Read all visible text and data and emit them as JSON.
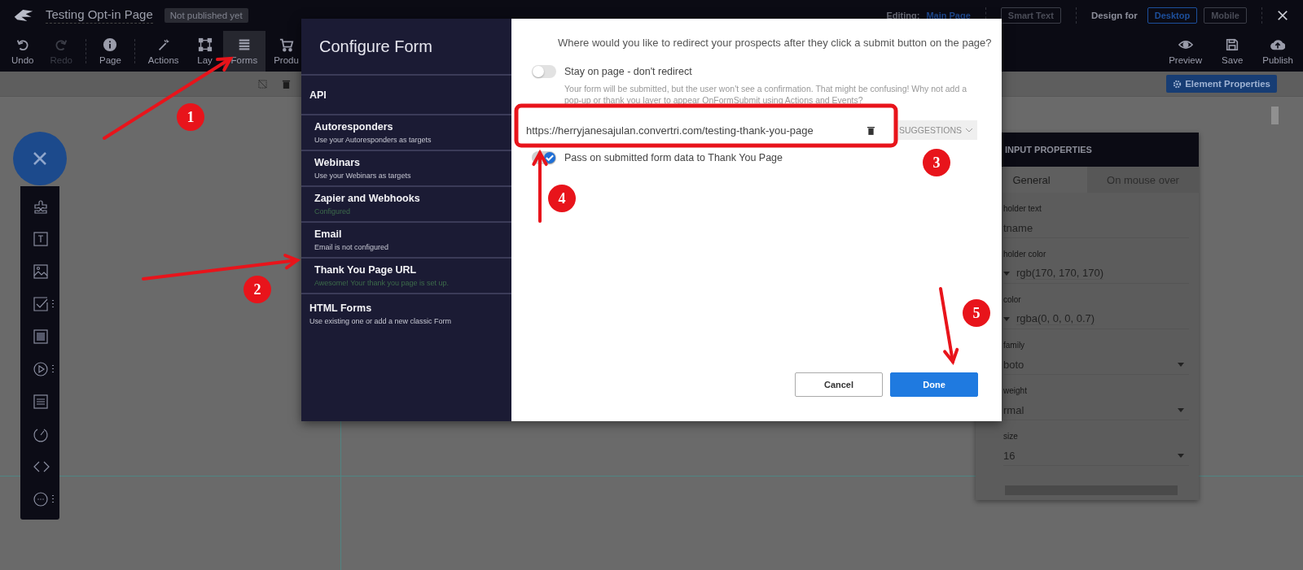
{
  "header": {
    "page_title": "Testing Opt-in Page",
    "status_badge": "Not published yet",
    "editing_label": "Editing:",
    "editing_page": "Main Page",
    "smart_text": "Smart Text",
    "design_for_label": "Design for",
    "devices": [
      {
        "label": "Desktop",
        "selected": true
      },
      {
        "label": "Mobile",
        "selected": false
      }
    ]
  },
  "toolbar": [
    {
      "kind": "undo",
      "label": "Undo",
      "disabled": false,
      "selected": false
    },
    {
      "kind": "redo",
      "label": "Redo",
      "disabled": true,
      "selected": false
    },
    {
      "kind": "page",
      "label": "Page",
      "disabled": false,
      "selected": false
    },
    {
      "kind": "actions",
      "label": "Actions",
      "disabled": false,
      "selected": false
    },
    {
      "kind": "layers",
      "label": "Lay",
      "disabled": false,
      "selected": false
    },
    {
      "kind": "forms",
      "label": "Forms",
      "disabled": false,
      "selected": true
    },
    {
      "kind": "cart",
      "label": "Produ",
      "disabled": false,
      "selected": false
    }
  ],
  "toolbar_right": [
    {
      "kind": "preview",
      "label": "Preview"
    },
    {
      "kind": "save",
      "label": "Save"
    },
    {
      "kind": "publish",
      "label": "Publish"
    }
  ],
  "element_properties_button": "Element Properties",
  "modal": {
    "title": "Configure Form",
    "menu": [
      {
        "kind": "group",
        "title": "API"
      },
      {
        "kind": "item",
        "title": "Autoresponders",
        "subtitle": "Use your Autoresponders as targets",
        "configured": false
      },
      {
        "kind": "item",
        "title": "Webinars",
        "subtitle": "Use your Webinars as targets",
        "configured": false
      },
      {
        "kind": "item",
        "title": "Zapier and Webhooks",
        "subtitle": "Configured",
        "configured": true
      },
      {
        "kind": "item",
        "title": "Email",
        "subtitle": "Email is not configured",
        "configured": false
      },
      {
        "kind": "item",
        "title": "Thank You Page URL",
        "subtitle": "Awesome! Your thank you page is set up.",
        "configured": true
      },
      {
        "kind": "group",
        "title": "HTML Forms",
        "subtitle": "Use existing one or add a new classic Form"
      }
    ],
    "question": "Where would you like to redirect your prospects after they click a submit button on the page?",
    "stay_toggle": {
      "label": "Stay on page - don't redirect",
      "on": false
    },
    "stay_help": "Your form will be submitted, but the user won't see a confirmation. That might be confusing! Why not add a pop-up or thank you layer to appear OnFormSubmit using Actions and Events?",
    "url": "https://herryjanesajulan.convertri.com/testing-thank-you-page",
    "suggestions": {
      "label": "SUGGESTIONS",
      "disabled": true
    },
    "pass_toggle": {
      "label": "Pass on submitted form data to Thank You Page",
      "on": true
    },
    "buttons": [
      {
        "kind": "secondary",
        "label": "Cancel"
      },
      {
        "kind": "primary",
        "label": "Done"
      }
    ]
  },
  "properties": {
    "title": "INPUT PROPERTIES",
    "tabs": [
      {
        "label": "General",
        "selected": true
      },
      {
        "label": "On mouse over",
        "selected": false
      }
    ],
    "fields": [
      {
        "kind": "text",
        "label": "holder text",
        "value": "tname"
      },
      {
        "kind": "color",
        "label": "holder color",
        "value": "rgb(170, 170, 170)"
      },
      {
        "kind": "color",
        "label": "color",
        "value": "rgba(0, 0, 0, 0.7)"
      },
      {
        "kind": "select",
        "label": "family",
        "value": "boto"
      },
      {
        "kind": "select",
        "label": "weight",
        "value": "rmal"
      },
      {
        "kind": "select",
        "label": "size",
        "value": "16"
      }
    ]
  },
  "annotations": [
    {
      "label": "1"
    },
    {
      "label": "2"
    },
    {
      "label": "3"
    },
    {
      "label": "4"
    },
    {
      "label": "5"
    }
  ]
}
